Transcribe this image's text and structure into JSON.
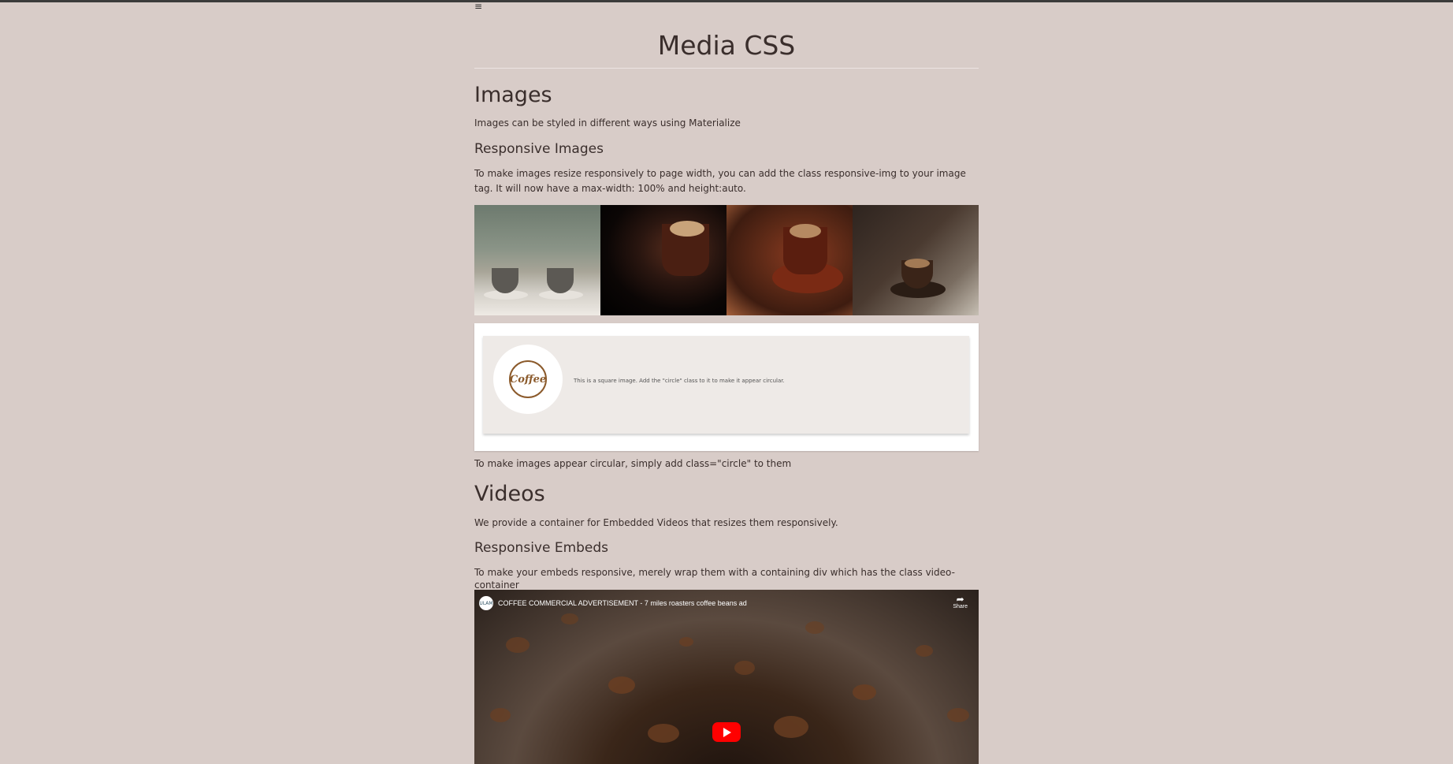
{
  "nav": {
    "menu_icon": "≡"
  },
  "page": {
    "title": "Media CSS"
  },
  "images": {
    "heading": "Images",
    "intro": "Images can be styled in different ways using Materialize",
    "responsive_heading": "Responsive Images",
    "responsive_text": "To make images resize responsively to page width, you can add the class responsive-img to your image tag. It will now have a max-width: 100% and height:auto.",
    "circle_card_text": "This is a square image. Add the \"circle\" class to it to make it appear circular.",
    "circle_logo_text": "Coffee",
    "circle_note": "To make images appear circular, simply add class=\"circle\" to them"
  },
  "videos": {
    "heading": "Videos",
    "intro": "We provide a container for Embedded Videos that resizes them responsively.",
    "embeds_heading": "Responsive Embeds",
    "embeds_text": "To make your embeds responsive, merely wrap them with a containing div which has the class video-container",
    "player": {
      "channel_avatar_text": "ULAM",
      "title": "COFFEE COMMERCIAL ADVERTISEMENT - 7 miles roasters coffee beans ad",
      "share_label": "Share",
      "share_icon": "share-icon",
      "play_icon": "youtube-play-icon",
      "play_color": "#ff0000"
    }
  },
  "colors": {
    "background": "#d8ccc8",
    "text": "#3a2e2c",
    "card": "#ffffff"
  }
}
